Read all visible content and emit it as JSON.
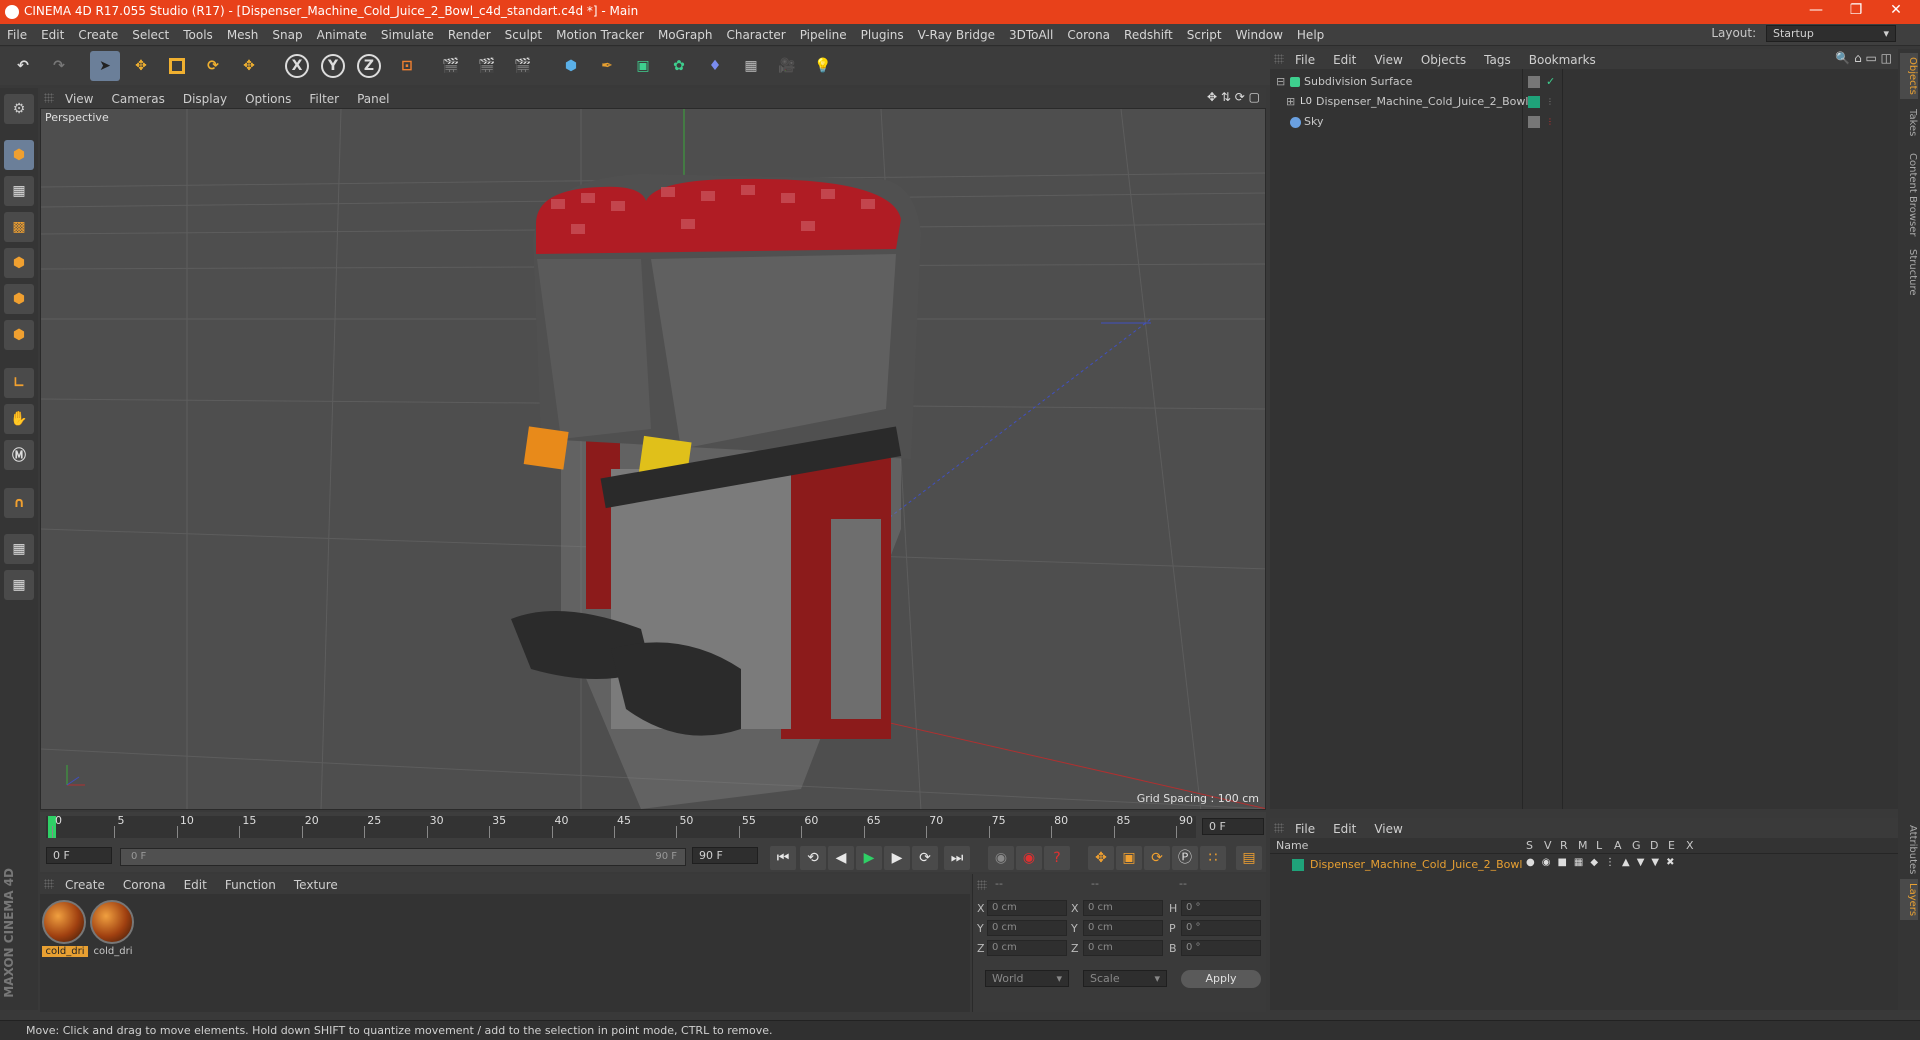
{
  "window": {
    "title": "CINEMA 4D R17.055 Studio (R17) - [Dispenser_Machine_Cold_Juice_2_Bowl_c4d_standart.c4d *] - Main"
  },
  "menubar": {
    "items": [
      "File",
      "Edit",
      "Create",
      "Select",
      "Tools",
      "Mesh",
      "Snap",
      "Animate",
      "Simulate",
      "Render",
      "Sculpt",
      "Motion Tracker",
      "MoGraph",
      "Character",
      "Pipeline",
      "Plugins",
      "V-Ray Bridge",
      "3DToAll",
      "Corona",
      "Redshift",
      "Script",
      "Window",
      "Help"
    ]
  },
  "layout": {
    "label": "Layout:",
    "value": "Startup"
  },
  "toolbar": {
    "axis_labels": [
      "X",
      "Y",
      "Z"
    ]
  },
  "viewport": {
    "menu": [
      "View",
      "Cameras",
      "Display",
      "Options",
      "Filter",
      "Panel"
    ],
    "camera_label": "Perspective",
    "grid_spacing": "Grid Spacing : 100 cm"
  },
  "timeline": {
    "ticks": [
      "0",
      "5",
      "10",
      "15",
      "20",
      "25",
      "30",
      "35",
      "40",
      "45",
      "50",
      "55",
      "60",
      "65",
      "70",
      "75",
      "80",
      "85",
      "90"
    ],
    "current_frame": "0 F",
    "start_field": "0 F",
    "range_start": "0 F",
    "range_end": "90 F",
    "end_field": "90 F"
  },
  "material_manager": {
    "menu": [
      "Create",
      "Corona",
      "Edit",
      "Function",
      "Texture"
    ],
    "materials": [
      {
        "name": "cold_dri"
      },
      {
        "name": "cold_dri"
      }
    ]
  },
  "coordinates": {
    "header": [
      "--",
      "--",
      "--"
    ],
    "rows": [
      {
        "a": "X",
        "av": "0 cm",
        "b": "X",
        "bv": "0 cm",
        "c": "H",
        "cv": "0 °"
      },
      {
        "a": "Y",
        "av": "0 cm",
        "b": "Y",
        "bv": "0 cm",
        "c": "P",
        "cv": "0 °"
      },
      {
        "a": "Z",
        "av": "0 cm",
        "b": "Z",
        "bv": "0 cm",
        "c": "B",
        "cv": "0 °"
      }
    ],
    "mode": "World",
    "scale": "Scale",
    "apply_label": "Apply"
  },
  "object_manager": {
    "menu": [
      "File",
      "Edit",
      "View",
      "Objects",
      "Tags",
      "Bookmarks"
    ],
    "objects": [
      {
        "name": "Subdivision Surface"
      },
      {
        "name": "Dispenser_Machine_Cold_Juice_2_Bowl"
      },
      {
        "name": "Sky"
      }
    ]
  },
  "layer_manager": {
    "menu": [
      "File",
      "Edit",
      "View"
    ],
    "header_name": "Name",
    "header_cols": [
      "S",
      "V",
      "R",
      "M",
      "L",
      "A",
      "G",
      "D",
      "E",
      "X"
    ],
    "layers": [
      {
        "name": "Dispenser_Machine_Cold_Juice_2_Bowl",
        "color": "#1fa37a"
      }
    ]
  },
  "right_tabs": [
    "Objects",
    "Takes",
    "Content Browser",
    "Structure",
    "Attributes",
    "Layers"
  ],
  "brand": "MAXON CINEMA 4D",
  "status": "Move: Click and drag to move elements. Hold down SHIFT to quantize movement / add to the selection in point mode, CTRL to remove.",
  "colors": {
    "accent_title": "#e8411a",
    "selected_object": "#e8a032"
  }
}
